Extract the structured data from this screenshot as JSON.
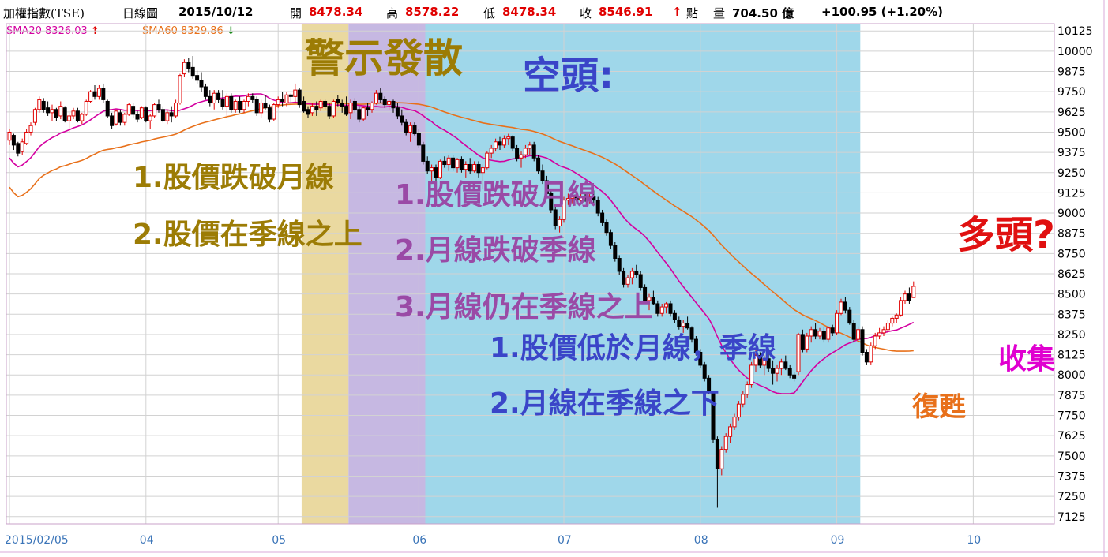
{
  "header": {
    "name": "加權指數(TSE)",
    "period": "日線圖",
    "date": "2015/10/12",
    "open_label": "開",
    "open": "8478.34",
    "high_label": "高",
    "high": "8578.22",
    "low_label": "低",
    "low": "8478.34",
    "close_label": "收",
    "close": "8546.91",
    "close_arrow": "↑",
    "close_unit": "點",
    "volume_label": "量",
    "volume": "704.50 億",
    "change": "+100.95 (+1.20%)"
  },
  "legend": {
    "sma20": "SMA20 8326.03",
    "sma20_arrow": "↑",
    "sma60": "SMA60 8329.86",
    "sma60_arrow": "↓"
  },
  "annotations": {
    "warning_title": "警示發散",
    "bear_title": "空頭:",
    "bull_title": "多頭?",
    "y1": "1.股價跌破月線",
    "y2": "2.股價在季線之上",
    "p1": "1.股價跌破月線",
    "p2": "2.月線跌破季線",
    "p3": "3.月線仍在季線之上",
    "b1": "1.股價低於月線，季線",
    "b2": "2.月線在季線之下",
    "recover": "復甦",
    "collect": "收集"
  },
  "colors": {
    "sma20": "#d400a0",
    "sma60": "#e8701a",
    "up": "#e00000",
    "down": "#000000",
    "zone_warning": "#ead9a0",
    "zone_divergence": "#c6b8e2",
    "zone_bear": "#9fd7ea",
    "axis_text": "#3a74b8",
    "grid": "#d2d2d2",
    "ann_olive": "#9c7c05",
    "ann_purple": "#9a4aa6",
    "ann_blue": "#3a45c8",
    "ann_red": "#e01010",
    "ann_orange": "#e8701a",
    "ann_magenta": "#e000d0"
  },
  "chart_data": {
    "type": "candlestick",
    "title": "加權指數(TSE) 日線圖",
    "x_tick_labels": [
      "2015/02/05",
      "04",
      "05",
      "06",
      "07",
      "08",
      "09",
      "10"
    ],
    "y_ticks": [
      7125,
      7250,
      7375,
      7500,
      7625,
      7750,
      7875,
      8000,
      8125,
      8250,
      8375,
      8500,
      8625,
      8750,
      8875,
      9000,
      9125,
      9250,
      9375,
      9500,
      9625,
      9750,
      9875,
      10000,
      10125
    ],
    "ylim": [
      7080,
      10170
    ],
    "grid": true,
    "x_ticks_index": [
      0,
      32,
      63,
      96,
      130,
      162,
      194,
      226
    ],
    "zones": [
      {
        "name": "warning",
        "from": 69,
        "to": 80
      },
      {
        "name": "divergence",
        "from": 80,
        "to": 98
      },
      {
        "name": "bear",
        "from": 98,
        "to": 200
      }
    ],
    "candles": [
      [
        9450,
        9520,
        9420,
        9500
      ],
      [
        9480,
        9490,
        9390,
        9420
      ],
      [
        9430,
        9440,
        9350,
        9370
      ],
      [
        9380,
        9460,
        9360,
        9440
      ],
      [
        9430,
        9520,
        9420,
        9500
      ],
      [
        9500,
        9560,
        9480,
        9540
      ],
      [
        9560,
        9650,
        9540,
        9640
      ],
      [
        9640,
        9720,
        9620,
        9700
      ],
      [
        9690,
        9710,
        9620,
        9640
      ],
      [
        9650,
        9690,
        9600,
        9620
      ],
      [
        9620,
        9670,
        9570,
        9640
      ],
      [
        9640,
        9650,
        9570,
        9590
      ],
      [
        9600,
        9690,
        9580,
        9660
      ],
      [
        9650,
        9660,
        9560,
        9570
      ],
      [
        9570,
        9620,
        9500,
        9600
      ],
      [
        9600,
        9650,
        9580,
        9630
      ],
      [
        9630,
        9650,
        9560,
        9570
      ],
      [
        9570,
        9620,
        9550,
        9610
      ],
      [
        9610,
        9700,
        9600,
        9690
      ],
      [
        9690,
        9760,
        9680,
        9750
      ],
      [
        9750,
        9790,
        9700,
        9720
      ],
      [
        9720,
        9790,
        9700,
        9770
      ],
      [
        9770,
        9800,
        9680,
        9700
      ],
      [
        9690,
        9700,
        9590,
        9600
      ],
      [
        9600,
        9620,
        9520,
        9540
      ],
      [
        9550,
        9640,
        9540,
        9630
      ],
      [
        9620,
        9640,
        9540,
        9560
      ],
      [
        9560,
        9620,
        9540,
        9610
      ],
      [
        9610,
        9680,
        9600,
        9670
      ],
      [
        9660,
        9680,
        9590,
        9610
      ],
      [
        9610,
        9630,
        9560,
        9580
      ],
      [
        9590,
        9660,
        9580,
        9650
      ],
      [
        9650,
        9660,
        9560,
        9570
      ],
      [
        9570,
        9610,
        9520,
        9600
      ],
      [
        9600,
        9680,
        9590,
        9670
      ],
      [
        9670,
        9700,
        9620,
        9640
      ],
      [
        9640,
        9660,
        9560,
        9570
      ],
      [
        9570,
        9640,
        9550,
        9620
      ],
      [
        9620,
        9660,
        9560,
        9600
      ],
      [
        9600,
        9700,
        9590,
        9680
      ],
      [
        9680,
        9860,
        9670,
        9850
      ],
      [
        9860,
        9950,
        9840,
        9930
      ],
      [
        9930,
        9960,
        9870,
        9890
      ],
      [
        9900,
        9970,
        9830,
        9850
      ],
      [
        9850,
        9880,
        9800,
        9820
      ],
      [
        9820,
        9870,
        9750,
        9780
      ],
      [
        9780,
        9800,
        9700,
        9720
      ],
      [
        9720,
        9760,
        9660,
        9680
      ],
      [
        9680,
        9760,
        9640,
        9740
      ],
      [
        9740,
        9760,
        9680,
        9700
      ],
      [
        9700,
        9760,
        9640,
        9660
      ],
      [
        9660,
        9740,
        9600,
        9720
      ],
      [
        9720,
        9740,
        9620,
        9640
      ],
      [
        9640,
        9700,
        9620,
        9690
      ],
      [
        9690,
        9720,
        9620,
        9640
      ],
      [
        9640,
        9700,
        9620,
        9690
      ],
      [
        9690,
        9740,
        9660,
        9720
      ],
      [
        9720,
        9740,
        9680,
        9700
      ],
      [
        9700,
        9720,
        9600,
        9620
      ],
      [
        9620,
        9700,
        9590,
        9680
      ],
      [
        9680,
        9730,
        9640,
        9650
      ],
      [
        9650,
        9670,
        9560,
        9580
      ],
      [
        9580,
        9680,
        9570,
        9670
      ],
      [
        9670,
        9720,
        9650,
        9700
      ],
      [
        9700,
        9750,
        9660,
        9690
      ],
      [
        9680,
        9750,
        9660,
        9730
      ],
      [
        9730,
        9740,
        9680,
        9720
      ],
      [
        9720,
        9800,
        9680,
        9760
      ],
      [
        9760,
        9770,
        9650,
        9670
      ],
      [
        9690,
        9720,
        9620,
        9630
      ],
      [
        9640,
        9660,
        9590,
        9610
      ],
      [
        9620,
        9680,
        9600,
        9660
      ],
      [
        9660,
        9690,
        9600,
        9640
      ],
      [
        9650,
        9700,
        9630,
        9690
      ],
      [
        9690,
        9700,
        9640,
        9660
      ],
      [
        9660,
        9680,
        9580,
        9600
      ],
      [
        9600,
        9700,
        9590,
        9690
      ],
      [
        9700,
        9730,
        9660,
        9680
      ],
      [
        9680,
        9700,
        9620,
        9660
      ],
      [
        9660,
        9720,
        9600,
        9610
      ],
      [
        9620,
        9700,
        9580,
        9680
      ],
      [
        9690,
        9710,
        9620,
        9640
      ],
      [
        9640,
        9660,
        9560,
        9580
      ],
      [
        9580,
        9660,
        9570,
        9650
      ],
      [
        9650,
        9680,
        9600,
        9640
      ],
      [
        9640,
        9690,
        9620,
        9680
      ],
      [
        9680,
        9760,
        9670,
        9740
      ],
      [
        9740,
        9770,
        9680,
        9700
      ],
      [
        9700,
        9720,
        9650,
        9670
      ],
      [
        9670,
        9700,
        9640,
        9690
      ],
      [
        9690,
        9700,
        9620,
        9650
      ],
      [
        9650,
        9680,
        9580,
        9600
      ],
      [
        9600,
        9640,
        9540,
        9560
      ],
      [
        9560,
        9580,
        9480,
        9500
      ],
      [
        9500,
        9560,
        9440,
        9540
      ],
      [
        9540,
        9560,
        9480,
        9490
      ],
      [
        9490,
        9520,
        9400,
        9420
      ],
      [
        9420,
        9440,
        9300,
        9320
      ],
      [
        9320,
        9350,
        9240,
        9260
      ],
      [
        9260,
        9300,
        9180,
        9280
      ],
      [
        9280,
        9300,
        9200,
        9220
      ],
      [
        9220,
        9330,
        9210,
        9320
      ],
      [
        9320,
        9350,
        9280,
        9300
      ],
      [
        9300,
        9360,
        9260,
        9340
      ],
      [
        9340,
        9360,
        9260,
        9280
      ],
      [
        9280,
        9340,
        9250,
        9330
      ],
      [
        9330,
        9350,
        9250,
        9270
      ],
      [
        9270,
        9320,
        9220,
        9300
      ],
      [
        9300,
        9340,
        9240,
        9260
      ],
      [
        9260,
        9320,
        9250,
        9300
      ],
      [
        9300,
        9320,
        9220,
        9250
      ],
      [
        9250,
        9300,
        9150,
        9280
      ],
      [
        9280,
        9380,
        9270,
        9370
      ],
      [
        9370,
        9420,
        9340,
        9400
      ],
      [
        9400,
        9460,
        9380,
        9440
      ],
      [
        9440,
        9470,
        9390,
        9420
      ],
      [
        9420,
        9480,
        9400,
        9460
      ],
      [
        9460,
        9490,
        9420,
        9470
      ],
      [
        9470,
        9480,
        9380,
        9400
      ],
      [
        9400,
        9420,
        9320,
        9340
      ],
      [
        9340,
        9380,
        9280,
        9360
      ],
      [
        9360,
        9420,
        9340,
        9400
      ],
      [
        9400,
        9440,
        9360,
        9420
      ],
      [
        9420,
        9440,
        9320,
        9340
      ],
      [
        9340,
        9360,
        9240,
        9260
      ],
      [
        9260,
        9300,
        9180,
        9200
      ],
      [
        9200,
        9230,
        9100,
        9120
      ],
      [
        9120,
        9150,
        9000,
        9020
      ],
      [
        9020,
        9040,
        8900,
        8920
      ],
      [
        8920,
        8980,
        8880,
        8960
      ],
      [
        8960,
        9100,
        8940,
        9080
      ],
      [
        9080,
        9120,
        9050,
        9090
      ],
      [
        9090,
        9120,
        9060,
        9100
      ],
      [
        9100,
        9130,
        9060,
        9080
      ],
      [
        9080,
        9120,
        9060,
        9100
      ],
      [
        9100,
        9130,
        9070,
        9090
      ],
      [
        9090,
        9120,
        9060,
        9100
      ],
      [
        9100,
        9140,
        9060,
        9080
      ],
      [
        9080,
        9100,
        8980,
        9000
      ],
      [
        9000,
        9020,
        8920,
        8940
      ],
      [
        8940,
        8960,
        8860,
        8880
      ],
      [
        8880,
        8900,
        8780,
        8800
      ],
      [
        8800,
        8820,
        8700,
        8720
      ],
      [
        8720,
        8740,
        8620,
        8640
      ],
      [
        8640,
        8660,
        8540,
        8560
      ],
      [
        8560,
        8620,
        8540,
        8600
      ],
      [
        8600,
        8660,
        8560,
        8640
      ],
      [
        8640,
        8680,
        8600,
        8620
      ],
      [
        8620,
        8640,
        8520,
        8540
      ],
      [
        8540,
        8560,
        8440,
        8460
      ],
      [
        8460,
        8500,
        8400,
        8480
      ],
      [
        8480,
        8520,
        8430,
        8440
      ],
      [
        8440,
        8460,
        8360,
        8380
      ],
      [
        8380,
        8440,
        8360,
        8420
      ],
      [
        8420,
        8450,
        8380,
        8440
      ],
      [
        8440,
        8460,
        8360,
        8380
      ],
      [
        8380,
        8400,
        8320,
        8340
      ],
      [
        8340,
        8360,
        8280,
        8300
      ],
      [
        8300,
        8340,
        8260,
        8320
      ],
      [
        8320,
        8360,
        8280,
        8290
      ],
      [
        8290,
        8300,
        8200,
        8220
      ],
      [
        8220,
        8240,
        8120,
        8140
      ],
      [
        8140,
        8160,
        8040,
        8060
      ],
      [
        8060,
        8080,
        7960,
        7980
      ],
      [
        7980,
        8000,
        7880,
        7900
      ],
      [
        7890,
        7900,
        7580,
        7600
      ],
      [
        7600,
        7620,
        7180,
        7420
      ],
      [
        7420,
        7560,
        7380,
        7540
      ],
      [
        7540,
        7640,
        7520,
        7620
      ],
      [
        7620,
        7700,
        7580,
        7680
      ],
      [
        7680,
        7760,
        7660,
        7740
      ],
      [
        7740,
        7840,
        7720,
        7820
      ],
      [
        7820,
        7900,
        7800,
        7880
      ],
      [
        7880,
        7960,
        7860,
        7940
      ],
      [
        7940,
        8080,
        7920,
        8060
      ],
      [
        8060,
        8160,
        8020,
        8120
      ],
      [
        8120,
        8140,
        8040,
        8060
      ],
      [
        8060,
        8120,
        8000,
        8100
      ],
      [
        8100,
        8130,
        8020,
        8040
      ],
      [
        8040,
        8090,
        7940,
        8010
      ],
      [
        8010,
        8060,
        7960,
        8040
      ],
      [
        8040,
        8100,
        8000,
        8080
      ],
      [
        8080,
        8120,
        8030,
        8040
      ],
      [
        8040,
        8060,
        7980,
        8000
      ],
      [
        8000,
        8020,
        7960,
        7980
      ],
      [
        8020,
        8260,
        8000,
        8250
      ],
      [
        8250,
        8280,
        8140,
        8160
      ],
      [
        8160,
        8260,
        8140,
        8240
      ],
      [
        8240,
        8300,
        8200,
        8280
      ],
      [
        8280,
        8320,
        8220,
        8240
      ],
      [
        8240,
        8290,
        8220,
        8270
      ],
      [
        8270,
        8300,
        8200,
        8220
      ],
      [
        8220,
        8300,
        8200,
        8290
      ],
      [
        8290,
        8310,
        8240,
        8260
      ],
      [
        8260,
        8400,
        8250,
        8380
      ],
      [
        8380,
        8470,
        8370,
        8450
      ],
      [
        8450,
        8480,
        8380,
        8400
      ],
      [
        8400,
        8420,
        8310,
        8320
      ],
      [
        8320,
        8340,
        8200,
        8220
      ],
      [
        8220,
        8300,
        8200,
        8280
      ],
      [
        8280,
        8300,
        8120,
        8140
      ],
      [
        8140,
        8160,
        8060,
        8080
      ],
      [
        8080,
        8200,
        8060,
        8180
      ],
      [
        8180,
        8260,
        8160,
        8240
      ],
      [
        8240,
        8290,
        8220,
        8260
      ],
      [
        8260,
        8300,
        8240,
        8280
      ],
      [
        8280,
        8340,
        8260,
        8320
      ],
      [
        8320,
        8360,
        8300,
        8350
      ],
      [
        8350,
        8380,
        8320,
        8370
      ],
      [
        8370,
        8480,
        8360,
        8460
      ],
      [
        8460,
        8520,
        8440,
        8500
      ],
      [
        8500,
        8540,
        8440,
        8460
      ],
      [
        8478,
        8578,
        8478,
        8547
      ]
    ]
  }
}
